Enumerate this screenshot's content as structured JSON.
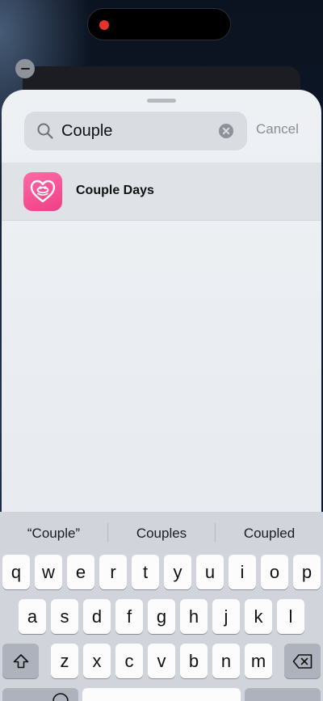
{
  "search": {
    "value": "Couple",
    "cancel_label": "Cancel"
  },
  "results": [
    {
      "name": "Couple Days",
      "icon": "heart-app-icon",
      "color": "#ef3f86"
    }
  ],
  "keyboard": {
    "predictions": [
      "“Couple”",
      "Couples",
      "Coupled"
    ],
    "row1": [
      "q",
      "w",
      "e",
      "r",
      "t",
      "y",
      "u",
      "i",
      "o",
      "p"
    ],
    "row2": [
      "a",
      "s",
      "d",
      "f",
      "g",
      "h",
      "j",
      "k",
      "l"
    ],
    "row3": [
      "z",
      "x",
      "c",
      "v",
      "b",
      "n",
      "m"
    ],
    "shift_icon": "shift-icon",
    "delete_icon": "backspace-icon",
    "emoji_icon": "emoji-icon"
  },
  "colors": {
    "record_indicator": "#e5322e",
    "app_icon_pink": "#ef3f86"
  }
}
